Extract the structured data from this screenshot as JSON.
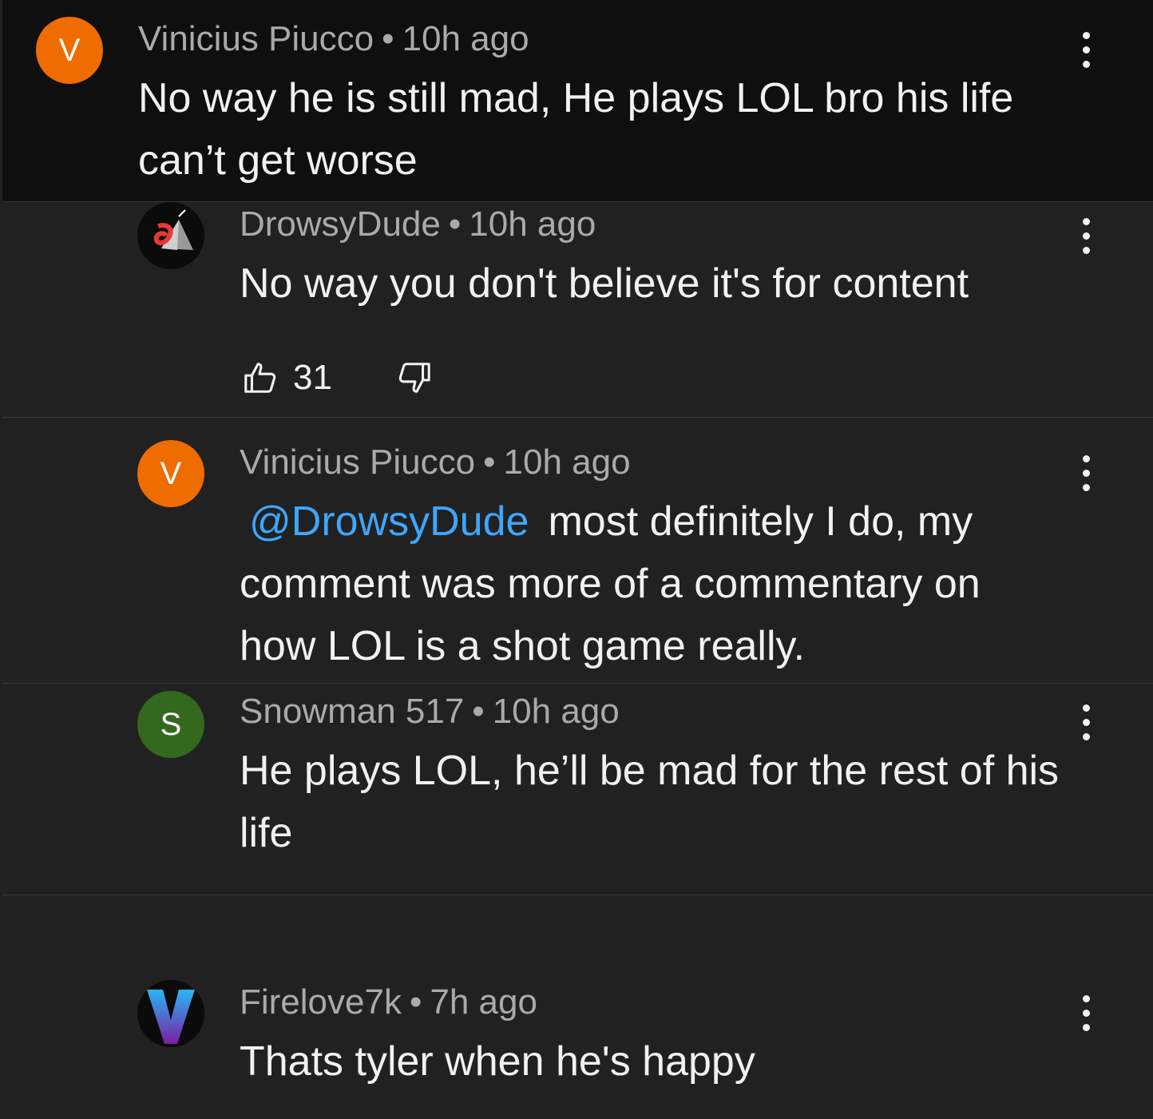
{
  "comments": [
    {
      "author": "Vinicius Piucco",
      "time": "10h ago",
      "avatar_letter": "V",
      "avatar_color": "#ef6c00",
      "text": "No way he is still mad, He plays LOL bro his life can’t get worse"
    },
    {
      "author": "DrowsyDude",
      "time": "10h ago",
      "avatar_icon": "drowsydude-logo-avatar",
      "text": "No way you don't believe it's for content",
      "likes": "31"
    },
    {
      "author": "Vinicius Piucco",
      "time": "10h ago",
      "avatar_letter": "V",
      "avatar_color": "#ef6c00",
      "mention": "@DrowsyDude",
      "text": "most definitely I do, my comment was more of a commentary on how LOL is a shot game really."
    },
    {
      "author": "Snowman 517",
      "time": "10h ago",
      "avatar_letter": "S",
      "avatar_color": "#33691e",
      "text": "He plays LOL, he’ll be mad for the rest of his life"
    },
    {
      "author": "Firelove7k",
      "time": "7h ago",
      "avatar_icon": "v-logo-avatar",
      "text": "Thats tyler when he's happy"
    }
  ],
  "separator": "•",
  "colors": {
    "background": "#212121",
    "highlight_background": "#0f0f0f",
    "mention": "#3ea6ff",
    "meta_text": "#aaaaaa"
  },
  "icons": {
    "menu": "more-vert-icon",
    "like": "thumbs-up-icon",
    "dislike": "thumbs-down-icon"
  }
}
